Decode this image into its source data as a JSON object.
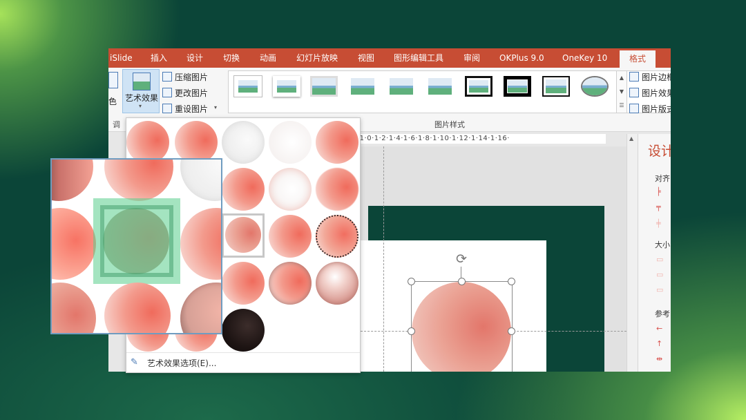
{
  "ribbon_tabs": [
    "iSlide",
    "插入",
    "设计",
    "切换",
    "动画",
    "幻灯片放映",
    "视图",
    "图形编辑工具",
    "审阅",
    "OKPlus 9.0",
    "OneKey 10",
    "格式"
  ],
  "adjust_group": {
    "color_label": "色",
    "artistic_effects_label": "艺术效果",
    "compress_label": "压缩图片",
    "change_label": "更改图片",
    "reset_label": "重设图片",
    "group_label": "调"
  },
  "picture_styles": {
    "group_label": "图片样式",
    "items": [
      "simple-frame",
      "simple-frame-2",
      "soft-shadow",
      "reflected",
      "reflected-bevel",
      "reflected-rounded",
      "thick-black-frame",
      "double-black-frame",
      "black-frame",
      "oval"
    ]
  },
  "right_commands": {
    "border_label": "图片边框",
    "effects_label": "图片效果",
    "layout_label": "图片版式"
  },
  "ruler_text": "·1·0·1·2·1·4·1·6·1·8·1·10·1·12·1·14·1·16·",
  "design_pane": {
    "title": "设计",
    "align_label": "对齐",
    "size_label": "大小",
    "ref_label": "参考"
  },
  "dropdown": {
    "footer_label": "艺术效果选项(E)..."
  },
  "colors": {
    "accent": "#c74d34",
    "background": "#0b4538",
    "highlight": "#5acd8c"
  }
}
